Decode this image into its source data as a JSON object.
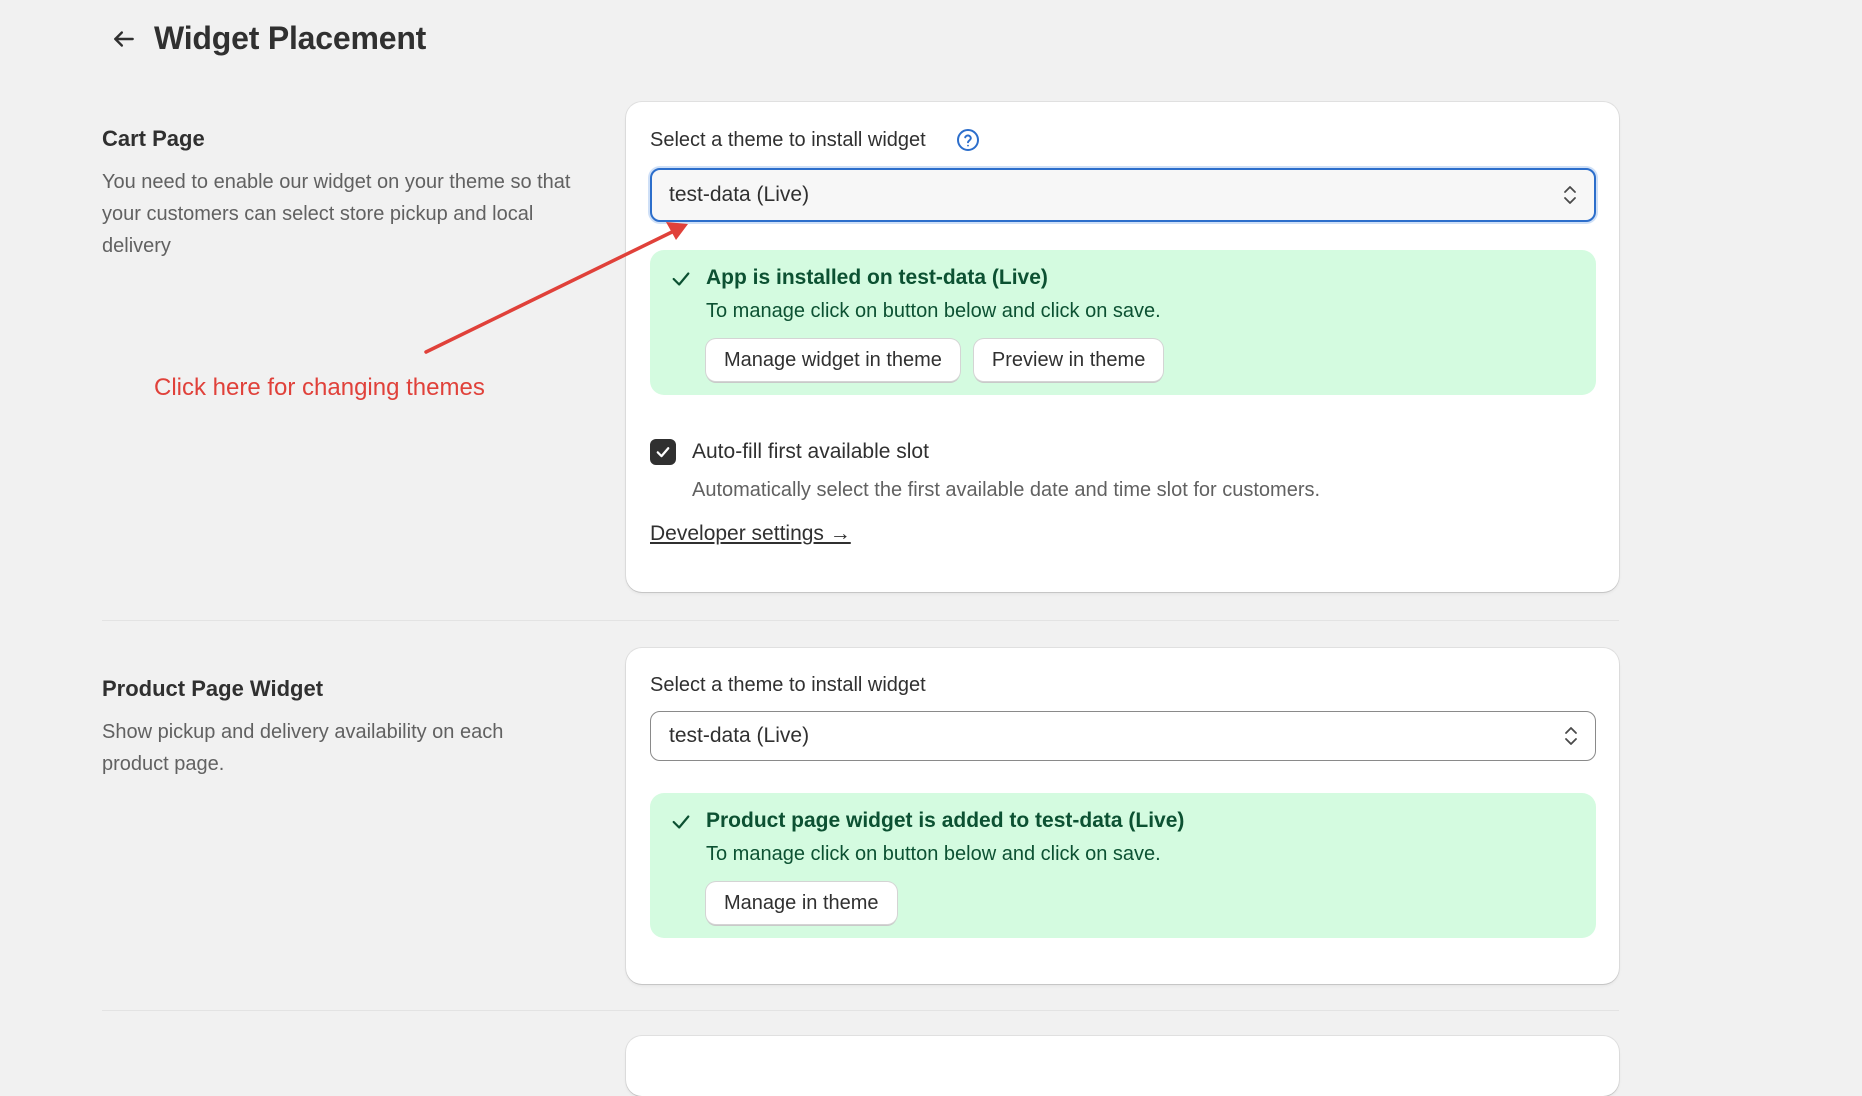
{
  "header": {
    "title": "Widget Placement",
    "back_icon": "arrow-left-icon"
  },
  "cart_section": {
    "title": "Cart Page",
    "description": "You need to enable our widget on your theme so that your customers can select store pickup and local delivery",
    "select_label": "Select a theme to install widget",
    "help_icon": "question-circle-icon",
    "selected_theme": "test-data (Live)",
    "banner": {
      "title": "App is installed on test-data (Live)",
      "text": "To manage click on button below and click on save.",
      "manage_button": "Manage widget in theme",
      "preview_button": "Preview in theme"
    },
    "autofill": {
      "checked": true,
      "label": "Auto-fill first available slot",
      "help": "Automatically select the first available date and time slot for customers."
    },
    "developer_link": "Developer settings →"
  },
  "product_section": {
    "title": "Product Page Widget",
    "description": "Show pickup and delivery availability on each product page.",
    "select_label": "Select a theme to install widget",
    "selected_theme": "test-data (Live)",
    "banner": {
      "title": "Product page widget is added to test-data (Live)",
      "text": "To manage click on button below and click on save.",
      "manage_button": "Manage in theme"
    }
  },
  "annotation": {
    "text": "Click here for changing themes",
    "color": "#e0413a"
  },
  "colors": {
    "success_bg": "#d4fbe0",
    "success_text": "#0c5132",
    "focus_ring": "#2c6ecb",
    "help_icon": "#2c6ecb"
  }
}
